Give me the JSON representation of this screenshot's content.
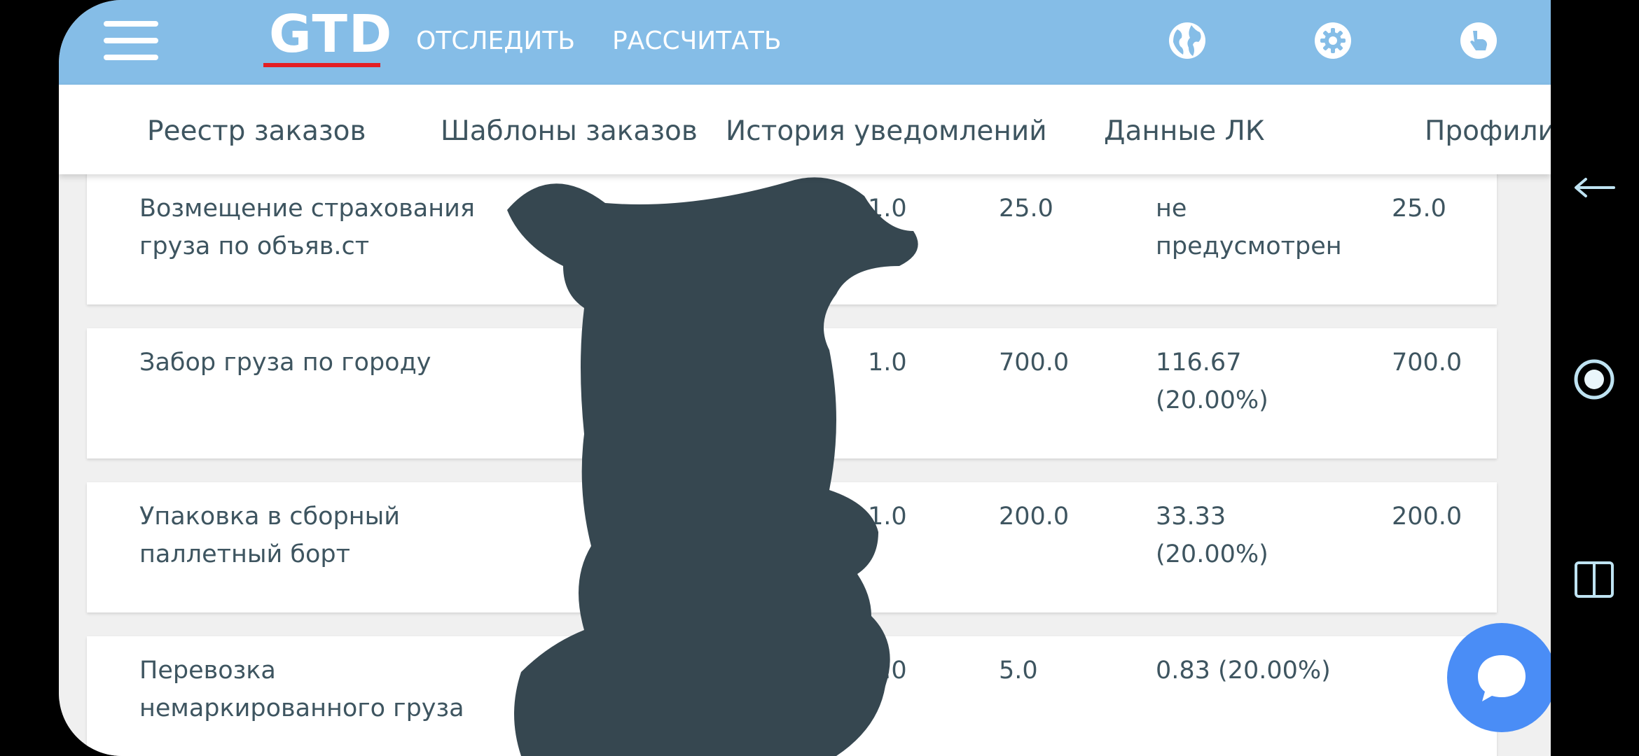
{
  "header": {
    "logo": "GTD",
    "nav": [
      "ОТСЛЕДИТЬ",
      "РАССЧИТАТЬ"
    ],
    "icons": [
      "menu-icon",
      "globe-icon",
      "gear-icon",
      "pointer-hand-icon"
    ]
  },
  "tabs": [
    "Реестр заказов",
    "Шаблоны заказов",
    "История уведомлений",
    "Данные ЛК",
    "Профили"
  ],
  "rows": [
    {
      "name": "Возмещение страхования груза по объяв.ст",
      "qty": "1.0",
      "price": "25.0",
      "vat": "не предусмотрен",
      "sum": "25.0"
    },
    {
      "name": "Забор груза по городу",
      "qty": "1.0",
      "price": "700.0",
      "vat": "116.67 (20.00%)",
      "sum": "700.0"
    },
    {
      "name": "Упаковка в сборный паллетный борт",
      "qty": "1.0",
      "price": "200.0",
      "vat": "33.33 (20.00%)",
      "sum": "200.0"
    },
    {
      "name": "Перевозка немаркированного груза",
      "qty": "1.0",
      "price": "5.0",
      "vat": "0.83 (20.00%)",
      "sum": ""
    }
  ],
  "colors": {
    "topbar": "#85bde7",
    "accent_underline": "#e31e24",
    "text": "#3e5560",
    "chat_button": "#4a8df6",
    "redaction": "#364750"
  },
  "floating": {
    "chat_icon": "chat-bubble-icon",
    "side_icons": [
      "back-arrow-icon",
      "floating-ball-icon",
      "split-screen-icon"
    ]
  }
}
